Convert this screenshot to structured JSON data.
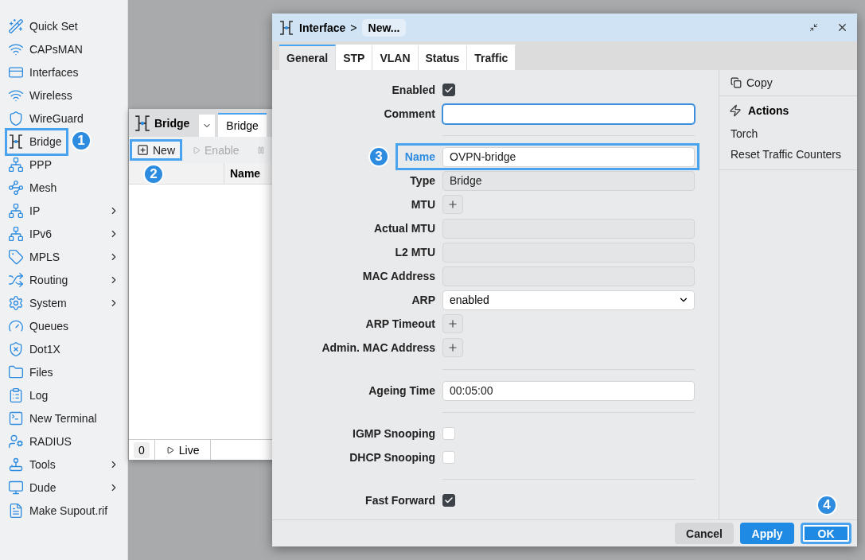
{
  "sidebar": {
    "items": [
      {
        "label": "Quick Set",
        "submenu": false,
        "highlighted": false
      },
      {
        "label": "CAPsMAN",
        "submenu": false,
        "highlighted": false
      },
      {
        "label": "Interfaces",
        "submenu": false,
        "highlighted": false
      },
      {
        "label": "Wireless",
        "submenu": false,
        "highlighted": false
      },
      {
        "label": "WireGuard",
        "submenu": false,
        "highlighted": false
      },
      {
        "label": "Bridge",
        "submenu": false,
        "highlighted": true,
        "callout": "1"
      },
      {
        "label": "PPP",
        "submenu": false,
        "highlighted": false
      },
      {
        "label": "Mesh",
        "submenu": false,
        "highlighted": false
      },
      {
        "label": "IP",
        "submenu": true,
        "highlighted": false
      },
      {
        "label": "IPv6",
        "submenu": true,
        "highlighted": false
      },
      {
        "label": "MPLS",
        "submenu": true,
        "highlighted": false
      },
      {
        "label": "Routing",
        "submenu": true,
        "highlighted": false
      },
      {
        "label": "System",
        "submenu": true,
        "highlighted": false
      },
      {
        "label": "Queues",
        "submenu": false,
        "highlighted": false
      },
      {
        "label": "Dot1X",
        "submenu": false,
        "highlighted": false
      },
      {
        "label": "Files",
        "submenu": false,
        "highlighted": false
      },
      {
        "label": "Log",
        "submenu": false,
        "highlighted": false
      },
      {
        "label": "New Terminal",
        "submenu": false,
        "highlighted": false
      },
      {
        "label": "RADIUS",
        "submenu": false,
        "highlighted": false
      },
      {
        "label": "Tools",
        "submenu": true,
        "highlighted": false
      },
      {
        "label": "Dude",
        "submenu": true,
        "highlighted": false
      },
      {
        "label": "Make Supout.rif",
        "submenu": false,
        "highlighted": false
      }
    ]
  },
  "bridge_window": {
    "title": "Bridge",
    "tabs": [
      {
        "label": "Bridge",
        "selected": true
      }
    ],
    "toolbar": [
      {
        "label": "New",
        "disabled": false,
        "highlighted": true,
        "callout": "2"
      },
      {
        "label": "Enable",
        "disabled": true,
        "highlighted": false
      },
      {
        "disabled": true,
        "highlighted": false
      }
    ],
    "columns": [
      "Name"
    ],
    "status_bar": {
      "count": "0",
      "live": "Live"
    }
  },
  "dialog": {
    "title": "Interface",
    "separator": ">",
    "breadcrumb": "New...",
    "tabs": [
      {
        "label": "General",
        "selected": true
      },
      {
        "label": "STP",
        "selected": false
      },
      {
        "label": "VLAN",
        "selected": false
      },
      {
        "label": "Status",
        "selected": false
      },
      {
        "label": "Traffic",
        "selected": false
      }
    ],
    "fields": [
      {
        "kind": "checkbox",
        "label": "Enabled",
        "checked": true
      },
      {
        "kind": "text",
        "label": "Comment",
        "focused": true,
        "highlighted": false
      },
      {
        "kind": "divider"
      },
      {
        "kind": "text",
        "label": "Name",
        "value": "OVPN-bridge",
        "focused": false,
        "highlighted": true,
        "callout": "3"
      },
      {
        "kind": "readonly",
        "label": "Type",
        "value": "Bridge"
      },
      {
        "kind": "plus",
        "label": "MTU"
      },
      {
        "kind": "readonly",
        "label": "Actual MTU"
      },
      {
        "kind": "readonly",
        "label": "L2 MTU"
      },
      {
        "kind": "readonly",
        "label": "MAC Address"
      },
      {
        "kind": "select",
        "label": "ARP",
        "value": "enabled"
      },
      {
        "kind": "plus",
        "label": "ARP Timeout"
      },
      {
        "kind": "plus",
        "label": "Admin. MAC Address"
      },
      {
        "kind": "divider"
      },
      {
        "kind": "text",
        "label": "Ageing Time",
        "value": "00:05:00",
        "focused": false,
        "highlighted": false
      },
      {
        "kind": "divider"
      },
      {
        "kind": "checkbox",
        "label": "IGMP Snooping",
        "checked": false
      },
      {
        "kind": "checkbox",
        "label": "DHCP Snooping",
        "checked": false
      },
      {
        "kind": "divider"
      },
      {
        "kind": "checkbox",
        "label": "Fast Forward",
        "checked": true
      }
    ],
    "side_panel": {
      "copy": "Copy",
      "actions_title": "Actions",
      "actions": [
        "Torch",
        "Reset Traffic Counters"
      ]
    },
    "buttons": [
      {
        "label": "Cancel",
        "kind": "secondary",
        "highlighted": false
      },
      {
        "label": "Apply",
        "kind": "primary",
        "highlighted": false
      },
      {
        "label": "OK",
        "kind": "primary",
        "highlighted": true,
        "callout": "4"
      }
    ]
  }
}
